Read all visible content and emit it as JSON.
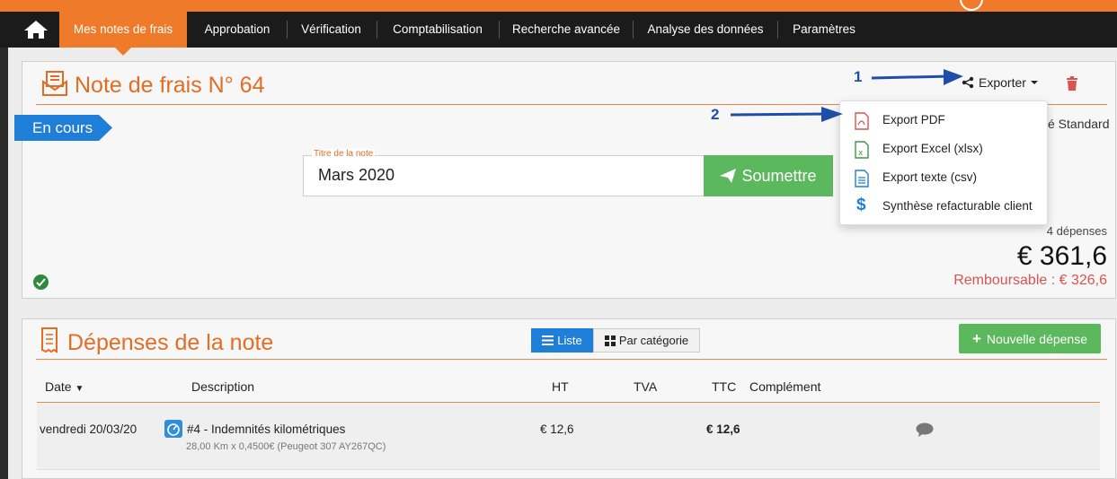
{
  "nav": {
    "tabs": [
      {
        "label": "Mes notes de frais",
        "active": true
      },
      {
        "label": "Approbation"
      },
      {
        "label": "Vérification"
      },
      {
        "label": "Comptabilisation"
      },
      {
        "label": "Recherche avancée"
      },
      {
        "label": "Analyse des données"
      },
      {
        "label": "Paramètres"
      }
    ]
  },
  "note": {
    "title": "Note de frais N° 64",
    "status": "En cours",
    "field_label": "Titre de la note",
    "field_value": "Mars 2020",
    "submit_label": "Soumettre",
    "partial_text": "é Standard",
    "expense_count": "4 dépenses",
    "total": "€ 361,6",
    "refund": "Remboursable :  € 326,6"
  },
  "export": {
    "label": "Exporter",
    "items": [
      {
        "label": "Export PDF",
        "icon": "pdf-file-icon"
      },
      {
        "label": "Export Excel (xlsx)",
        "icon": "excel-file-icon"
      },
      {
        "label": "Export texte (csv)",
        "icon": "text-file-icon"
      },
      {
        "label": "Synthèse refacturable client",
        "icon": "dollar-icon"
      }
    ]
  },
  "annotations": {
    "one": "1",
    "two": "2"
  },
  "expenses": {
    "title": "Dépenses de la note",
    "view_list": "Liste",
    "view_category": "Par catégorie",
    "new_button": "Nouvelle dépense",
    "columns": {
      "date": "Date",
      "description": "Description",
      "ht": "HT",
      "tva": "TVA",
      "ttc": "TTC",
      "complement": "Complément"
    },
    "rows": [
      {
        "date": "vendredi 20/03/20",
        "description": "#4 - Indemnités kilométriques",
        "detail": "28,00 Km x 0,4500€ (Peugeot 307 AY267QC)",
        "ht": "€ 12,6",
        "tva": "",
        "ttc": "€ 12,6"
      }
    ]
  },
  "colors": {
    "accent": "#ef7b2a",
    "title": "#e26d25",
    "primary": "#1f7ed8",
    "success": "#5cb85c",
    "danger": "#d9534f"
  }
}
